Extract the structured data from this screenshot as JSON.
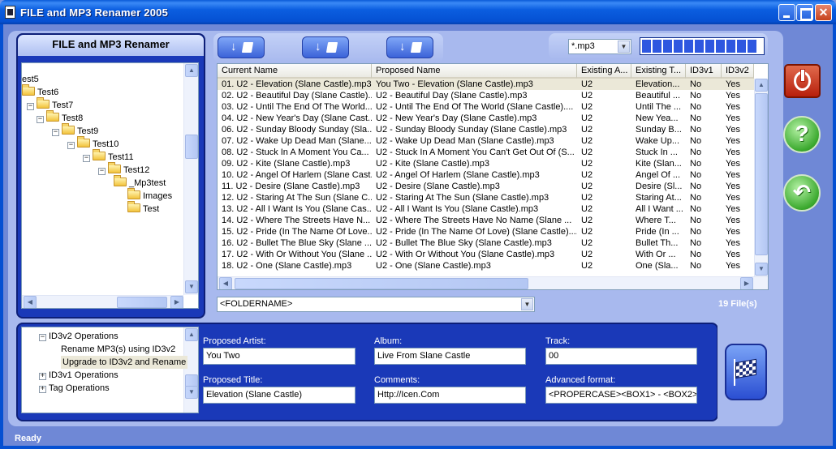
{
  "window": {
    "title": "FILE and MP3 Renamer 2005"
  },
  "tree_panel": {
    "header": "FILE and MP3 Renamer"
  },
  "tree": [
    {
      "label": "",
      "expander": "",
      "folder": false
    },
    {
      "label": "est5",
      "expander": "",
      "folder": false
    },
    {
      "label": "Test6",
      "expander": "",
      "folder": true
    },
    {
      "label": "Test7",
      "expander": "−",
      "folder": true
    },
    {
      "label": "Test8",
      "expander": "−",
      "folder": true
    },
    {
      "label": "Test9",
      "expander": "−",
      "folder": true
    },
    {
      "label": "Test10",
      "expander": "−",
      "folder": true
    },
    {
      "label": "Test11",
      "expander": "−",
      "folder": true
    },
    {
      "label": "Test12",
      "expander": "−",
      "folder": true
    },
    {
      "label": "_Mp3test",
      "expander": "",
      "folder": true
    },
    {
      "label": "Images",
      "expander": "",
      "folder": true
    },
    {
      "label": "Test",
      "expander": "",
      "folder": true
    }
  ],
  "toolbar": {
    "buttons": [
      "move-down-file",
      "move-down-files",
      "move-up"
    ]
  },
  "filter": {
    "mask": "*.mp3",
    "progress_fraction": 1.0
  },
  "file_list": {
    "columns": [
      "Current Name",
      "Proposed Name",
      "Existing A...",
      "Existing T...",
      "ID3v1",
      "ID3v2"
    ],
    "rows": [
      [
        "01. U2 - Elevation (Slane Castle).mp3",
        "You Two - Elevation (Slane Castle).mp3",
        "U2",
        "Elevation...",
        "No",
        "Yes"
      ],
      [
        "02. U2 - Beautiful Day (Slane Castle)....",
        "U2 - Beautiful Day (Slane Castle).mp3",
        "U2",
        "Beautiful ...",
        "No",
        "Yes"
      ],
      [
        "03. U2 - Until The End Of The World...",
        "U2 - Until The End Of The World (Slane Castle)....",
        "U2",
        "Until The ...",
        "No",
        "Yes"
      ],
      [
        "04. U2 - New Year's Day (Slane Cast...",
        "U2 - New Year's Day (Slane Castle).mp3",
        "U2",
        "New Yea...",
        "No",
        "Yes"
      ],
      [
        "06. U2 - Sunday Bloody Sunday (Sla...",
        "U2 - Sunday Bloody Sunday (Slane Castle).mp3",
        "U2",
        "Sunday B...",
        "No",
        "Yes"
      ],
      [
        "07. U2 - Wake Up Dead Man (Slane...",
        "U2 - Wake Up Dead Man (Slane Castle).mp3",
        "U2",
        "Wake Up...",
        "No",
        "Yes"
      ],
      [
        "08. U2 - Stuck In A Moment You Ca...",
        "U2 - Stuck In A Moment You Can't Get Out Of (S...",
        "U2",
        "Stuck In ...",
        "No",
        "Yes"
      ],
      [
        "09. U2 - Kite (Slane Castle).mp3",
        "U2 - Kite (Slane Castle).mp3",
        "U2",
        "Kite (Slan...",
        "No",
        "Yes"
      ],
      [
        "10. U2 - Angel Of Harlem (Slane Cast...",
        "U2 - Angel Of Harlem (Slane Castle).mp3",
        "U2",
        "Angel Of ...",
        "No",
        "Yes"
      ],
      [
        "11. U2 - Desire (Slane Castle).mp3",
        "U2 - Desire (Slane Castle).mp3",
        "U2",
        "Desire (Sl...",
        "No",
        "Yes"
      ],
      [
        "12. U2 - Staring At The Sun (Slane C...",
        "U2 - Staring At The Sun (Slane Castle).mp3",
        "U2",
        "Staring At...",
        "No",
        "Yes"
      ],
      [
        "13. U2 - All I Want Is You (Slane Cas...",
        "U2 - All I Want Is You (Slane Castle).mp3",
        "U2",
        "All I Want ...",
        "No",
        "Yes"
      ],
      [
        "14. U2 - Where The Streets Have N...",
        "U2 - Where The Streets Have No Name (Slane ...",
        "U2",
        "Where T...",
        "No",
        "Yes"
      ],
      [
        "15. U2 - Pride (In The Name Of Love...",
        "U2 - Pride (In The Name Of Love) (Slane Castle)....",
        "U2",
        "Pride (In ...",
        "No",
        "Yes"
      ],
      [
        "16. U2 - Bullet The Blue Sky (Slane ...",
        "U2 - Bullet The Blue Sky (Slane Castle).mp3",
        "U2",
        "Bullet Th...",
        "No",
        "Yes"
      ],
      [
        "17. U2 - With Or Without You (Slane ...",
        "U2 - With Or Without You (Slane Castle).mp3",
        "U2",
        "With Or ...",
        "No",
        "Yes"
      ],
      [
        "18. U2 - One (Slane Castle).mp3",
        "U2 - One (Slane Castle).mp3",
        "U2",
        "One (Sla...",
        "No",
        "Yes"
      ]
    ]
  },
  "folder_format": {
    "value": "<FOLDERNAME>"
  },
  "file_count": "19 File(s)",
  "operations_tree": [
    {
      "label": "ID3v2 Operations",
      "expander": "−",
      "level": 0,
      "selected": false
    },
    {
      "label": "Rename MP3(s) using ID3v2",
      "expander": "",
      "level": 1,
      "selected": false
    },
    {
      "label": "Upgrade to ID3v2 and Rename",
      "expander": "",
      "level": 1,
      "selected": true
    },
    {
      "label": "ID3v1 Operations",
      "expander": "+",
      "level": 0,
      "selected": false
    },
    {
      "label": "Tag Operations",
      "expander": "+",
      "level": 0,
      "selected": false
    }
  ],
  "form": {
    "proposed_artist_label": "Proposed Artist:",
    "proposed_artist_value": "You Two",
    "album_label": "Album:",
    "album_value": "Live From Slane Castle",
    "track_label": "Track:",
    "track_value": "00",
    "proposed_title_label": "Proposed Title:",
    "proposed_title_value": "Elevation (Slane Castle)",
    "comments_label": "Comments:",
    "comments_value": "Http://Icen.Com",
    "advanced_format_label": "Advanced format:",
    "advanced_format_value": "<PROPERCASE><BOX1> - <BOX2><"
  },
  "status": {
    "text": "Ready"
  },
  "colors": {
    "window_blue": "#0550d2",
    "panel_navy": "#1a39b8",
    "panel_light": "#a8b9ee",
    "selection": "#ebe8d8"
  },
  "icons": [
    "power-icon",
    "help-icon",
    "back-arrow-icon",
    "checkered-flag-icon",
    "folder-icon"
  ]
}
